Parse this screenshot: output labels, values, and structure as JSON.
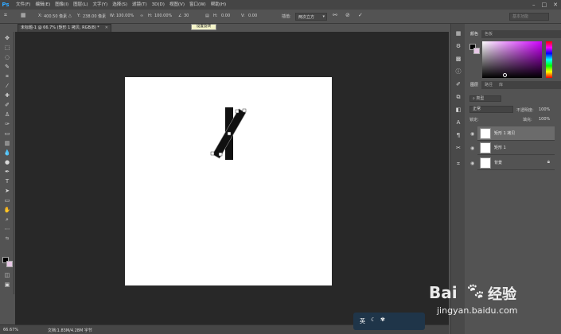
{
  "menubar": {
    "logo": "Ps",
    "items": [
      "文件(F)",
      "编辑(E)",
      "图像(I)",
      "图层(L)",
      "文字(Y)",
      "选择(S)",
      "滤镜(T)",
      "3D(D)",
      "视图(V)",
      "窗口(W)",
      "帮助(H)"
    ]
  },
  "options": {
    "x_label": "X:",
    "x_value": "400.50 像素",
    "y_label": "Y:",
    "y_value": "238.00 像素",
    "w_label": "W:",
    "w_value": "100.00%",
    "h_label": "H:",
    "h_value": "100.00%",
    "angle_value": "30",
    "hskew_label": "H:",
    "hskew_value": "0.00",
    "vskew_label": "V:",
    "vskew_value": "0.00",
    "interp_label": "插值:",
    "interp_value": "两次立方",
    "workspace": "基本功能",
    "tooltip": "设置旋转"
  },
  "document": {
    "tab_title": "未标题-1 @ 66.7% (矩形 1 拷贝, RGB/8) *"
  },
  "status": {
    "zoom": "66.67%",
    "doc_info": "文档:1.83M/4.28M 字节"
  },
  "panels": {
    "color_tabs": [
      "颜色",
      "色板"
    ],
    "layer_tabs": [
      "图层",
      "路径",
      "库"
    ],
    "kind_label": "类型",
    "blend_mode": "正常",
    "opacity_label": "不透明度:",
    "opacity_value": "100%",
    "lock_label": "锁定:",
    "fill_label": "填充:",
    "fill_value": "100%",
    "layers": [
      {
        "name": "矩形 1 拷贝",
        "selected": true
      },
      {
        "name": "矩形 1",
        "selected": false
      },
      {
        "name": "背景",
        "selected": false
      }
    ]
  },
  "taskbar": {
    "ime": "英"
  },
  "watermark": {
    "brand": "Bai",
    "brand2": "经验",
    "url": "jingyan.baidu.com"
  }
}
